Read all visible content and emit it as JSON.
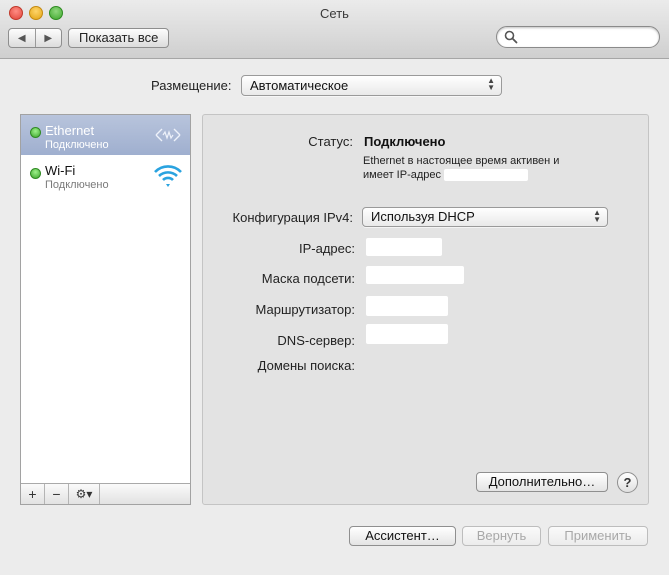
{
  "window": {
    "title": "Сеть"
  },
  "toolbar": {
    "back_glyph": "◀",
    "forward_glyph": "▶",
    "show_all_label": "Показать все",
    "search_placeholder": ""
  },
  "location": {
    "label": "Размещение:",
    "value": "Автоматическое"
  },
  "services": [
    {
      "name": "Ethernet",
      "status": "Подключено",
      "selected": true,
      "icon": "ethernet-icon"
    },
    {
      "name": "Wi-Fi",
      "status": "Подключено",
      "selected": false,
      "icon": "wifi-icon"
    }
  ],
  "sidebar_toolbar": {
    "add": "+",
    "remove": "−",
    "gear": "⚙▾"
  },
  "detail": {
    "status_label": "Статус:",
    "status_value": "Подключено",
    "status_desc_line1": "Ethernet в настоящее время активен и",
    "status_desc_line2": "имеет IP-адрес",
    "ipv4_label": "Конфигурация IPv4:",
    "ipv4_value": "Используя DHCP",
    "ip_label": "IP-адрес:",
    "mask_label": "Маска подсети:",
    "router_label": "Маршрутизатор:",
    "dns_label": "DNS-сервер:",
    "domains_label": "Домены поиска:",
    "advanced_label": "Дополнительно…",
    "help_label": "?"
  },
  "footer": {
    "assistant_label": "Ассистент…",
    "revert_label": "Вернуть",
    "apply_label": "Применить"
  },
  "colors": {
    "selection": "#a8b7d5",
    "status_green": "#3ba52a",
    "wifi_blue": "#2aa3e0"
  }
}
